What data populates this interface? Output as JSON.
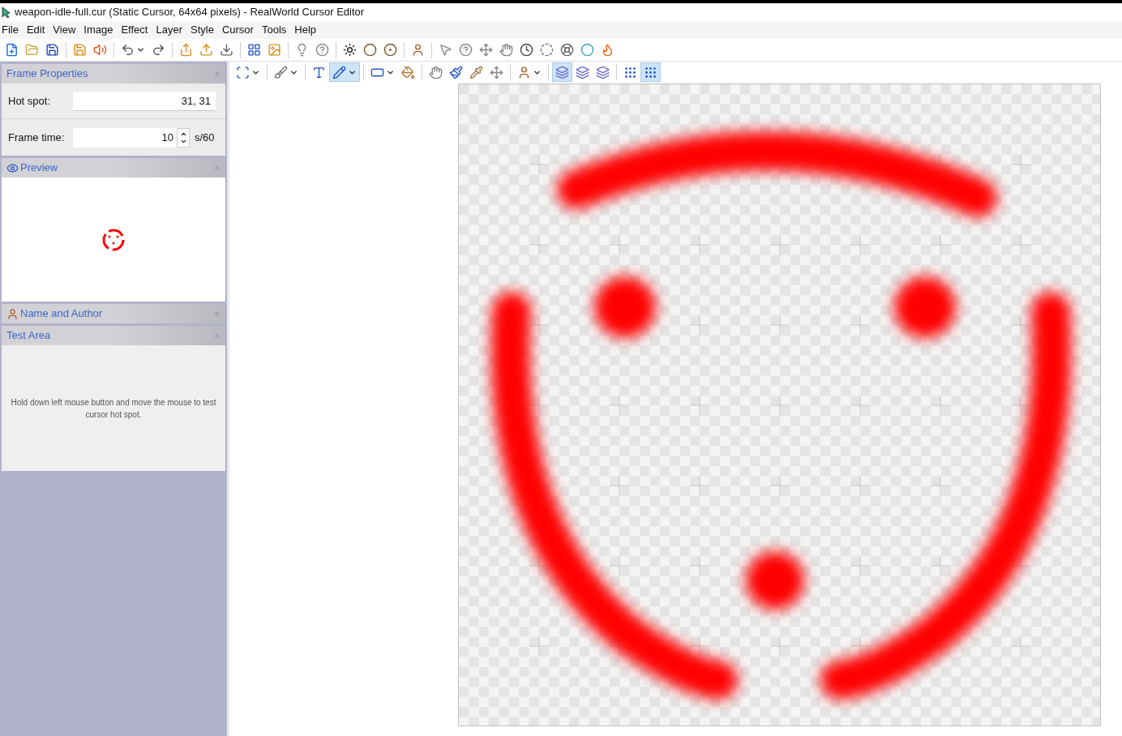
{
  "window": {
    "title": "weapon-idle-full.cur (Static Cursor, 64x64 pixels) - RealWorld Cursor Editor"
  },
  "menu": [
    "File",
    "Edit",
    "View",
    "Image",
    "Effect",
    "Layer",
    "Style",
    "Cursor",
    "Tools",
    "Help"
  ],
  "toolbar": [
    {
      "kind": "new"
    },
    {
      "kind": "open"
    },
    {
      "kind": "save"
    },
    {
      "kind": "sep"
    },
    {
      "kind": "save-all"
    },
    {
      "kind": "sound"
    },
    {
      "kind": "sep"
    },
    {
      "kind": "undo",
      "dropdown": true
    },
    {
      "kind": "redo"
    },
    {
      "kind": "sep"
    },
    {
      "kind": "export"
    },
    {
      "kind": "upload"
    },
    {
      "kind": "download"
    },
    {
      "kind": "sep"
    },
    {
      "kind": "grid-image"
    },
    {
      "kind": "image-edit"
    },
    {
      "kind": "sep"
    },
    {
      "kind": "bulb"
    },
    {
      "kind": "help-cursor"
    },
    {
      "kind": "sep"
    },
    {
      "kind": "sun"
    },
    {
      "kind": "ball"
    },
    {
      "kind": "ring-ball"
    },
    {
      "kind": "sep"
    },
    {
      "kind": "person"
    },
    {
      "kind": "sep"
    },
    {
      "kind": "arrow"
    },
    {
      "kind": "question"
    },
    {
      "kind": "move"
    },
    {
      "kind": "hand"
    },
    {
      "kind": "clock"
    },
    {
      "kind": "dots"
    },
    {
      "kind": "lifebuoy"
    },
    {
      "kind": "ring"
    },
    {
      "kind": "fire"
    }
  ],
  "tools": [
    {
      "kind": "select",
      "selected": false,
      "dropdown": true
    },
    {
      "kind": "sep"
    },
    {
      "kind": "brush",
      "selected": false,
      "dropdown": true
    },
    {
      "kind": "sep"
    },
    {
      "kind": "text",
      "selected": false
    },
    {
      "kind": "pencil",
      "selected": true,
      "dropdown": true
    },
    {
      "kind": "sep"
    },
    {
      "kind": "rect",
      "selected": false,
      "dropdown": true
    },
    {
      "kind": "fill",
      "selected": false
    },
    {
      "kind": "sep"
    },
    {
      "kind": "hand",
      "selected": false
    },
    {
      "kind": "paint",
      "selected": false
    },
    {
      "kind": "pipette",
      "selected": false
    },
    {
      "kind": "move",
      "selected": false
    },
    {
      "kind": "sep"
    },
    {
      "kind": "person",
      "selected": false,
      "dropdown": true
    },
    {
      "kind": "sep"
    },
    {
      "kind": "layer",
      "selected": true
    },
    {
      "kind": "layer",
      "selected": false
    },
    {
      "kind": "layer",
      "selected": false
    },
    {
      "kind": "sep"
    },
    {
      "kind": "grid",
      "selected": false
    },
    {
      "kind": "grid",
      "selected": true
    }
  ],
  "frame_properties": {
    "title": "Frame Properties",
    "hot_spot_label": "Hot spot:",
    "hot_spot": "31, 31",
    "frame_time_label": "Frame time:",
    "frame_time": "10",
    "frame_time_unit": "s/60"
  },
  "preview": {
    "title": "Preview"
  },
  "name_and_author": {
    "title": "Name and Author",
    "expanded": false
  },
  "test_area": {
    "title": "Test Area",
    "hint": "Hold down left mouse button and move the mouse to test cursor hot spot."
  }
}
